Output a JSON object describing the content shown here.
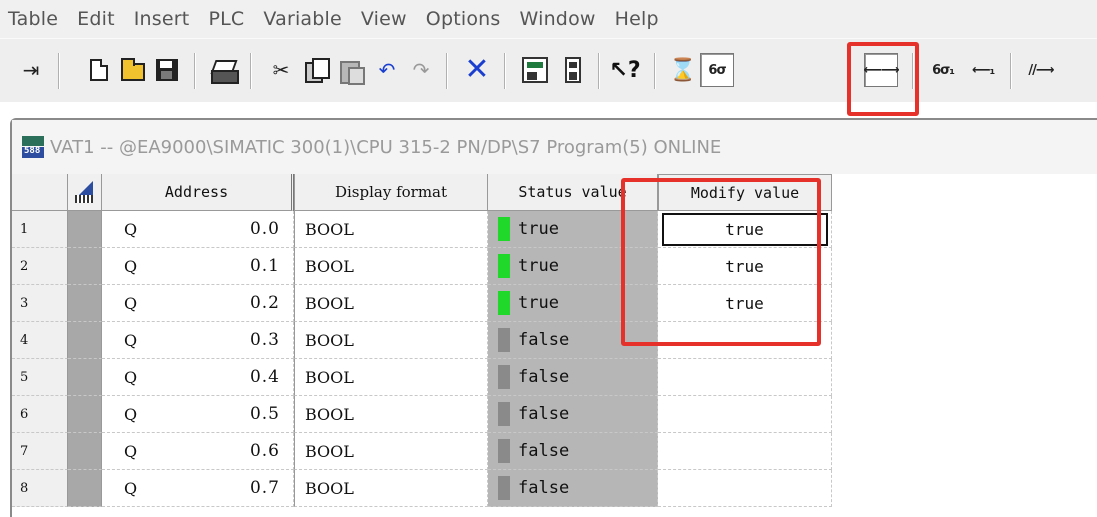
{
  "menu": [
    "Table",
    "Edit",
    "Insert",
    "PLC",
    "Variable",
    "View",
    "Options",
    "Window",
    "Help"
  ],
  "toolbar": {
    "icons": [
      "pin-icon",
      "new-icon",
      "open-folder-icon",
      "save-icon",
      "print-icon",
      "cut-icon",
      "copy-icon",
      "paste-icon",
      "undo-icon",
      "redo-icon",
      "delete-icon",
      "accessible-nodes-icon",
      "cpu-icon",
      "whats-this-icon",
      "monitor-icon",
      "monitor-variable-icon",
      "modify-variable-icon",
      "update-monitor-icon",
      "activate-modify-icon",
      "enable-peripheral-icon"
    ],
    "highlighted": "modify-variable-icon",
    "labels": {
      "monitor": "6σ",
      "modify": "⟵⟶",
      "monitor_once": "6σ₁",
      "modify_once": "⟵₁",
      "enable": "//⟶"
    }
  },
  "window": {
    "title": "VAT1 -- @EA9000\\SIMATIC 300(1)\\CPU 315-2 PN/DP\\S7 Program(5)  ONLINE",
    "icon_text": "588"
  },
  "table": {
    "headers": {
      "address": "Address",
      "display_format": "Display format",
      "status_value": "Status value",
      "modify_value": "Modify value"
    },
    "rows": [
      {
        "num": "1",
        "area": "Q",
        "addr": "0.0",
        "format": "BOOL",
        "status": "true",
        "status_on": true,
        "modify": "true"
      },
      {
        "num": "2",
        "area": "Q",
        "addr": "0.1",
        "format": "BOOL",
        "status": "true",
        "status_on": true,
        "modify": "true"
      },
      {
        "num": "3",
        "area": "Q",
        "addr": "0.2",
        "format": "BOOL",
        "status": "true",
        "status_on": true,
        "modify": "true"
      },
      {
        "num": "4",
        "area": "Q",
        "addr": "0.3",
        "format": "BOOL",
        "status": "false",
        "status_on": false,
        "modify": ""
      },
      {
        "num": "5",
        "area": "Q",
        "addr": "0.4",
        "format": "BOOL",
        "status": "false",
        "status_on": false,
        "modify": ""
      },
      {
        "num": "6",
        "area": "Q",
        "addr": "0.5",
        "format": "BOOL",
        "status": "false",
        "status_on": false,
        "modify": ""
      },
      {
        "num": "7",
        "area": "Q",
        "addr": "0.6",
        "format": "BOOL",
        "status": "false",
        "status_on": false,
        "modify": ""
      },
      {
        "num": "8",
        "area": "Q",
        "addr": "0.7",
        "format": "BOOL",
        "status": "false",
        "status_on": false,
        "modify": ""
      }
    ]
  },
  "colors": {
    "highlight": "#e53129",
    "led_on": "#20d82a",
    "led_off": "#8a8a8a"
  }
}
